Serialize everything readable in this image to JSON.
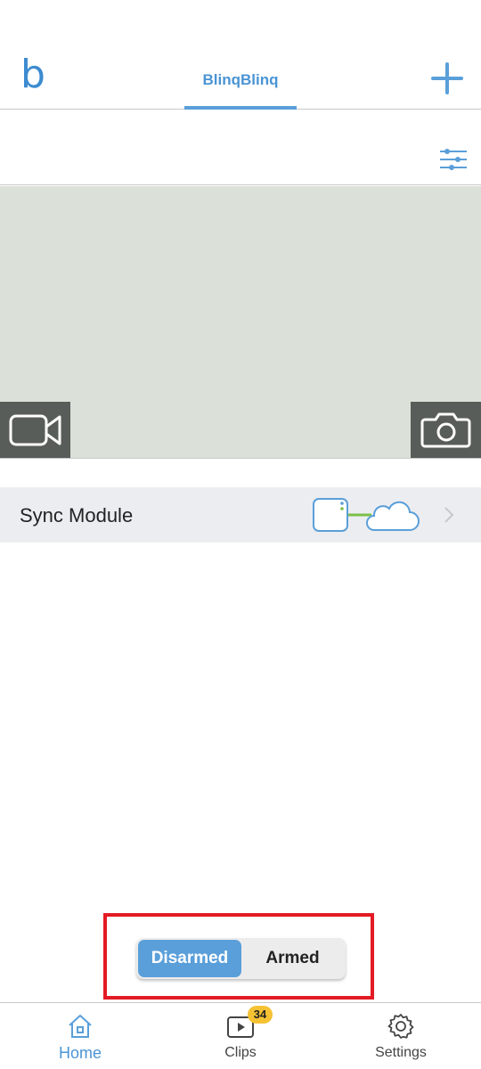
{
  "header": {
    "logo": "b",
    "system_tab": "BlinqBlinq",
    "accent_color": "#5a9fd9",
    "add_icon": "plus-icon"
  },
  "filter": {
    "icon": "sliders-icon"
  },
  "camera": {
    "live_view_icon": "video-camera-icon",
    "snapshot_icon": "camera-icon"
  },
  "sync_module": {
    "label": "Sync Module",
    "status_icon": "module-cloud-connected-icon",
    "status_color": "#7bbf4a"
  },
  "arm_toggle": {
    "disarmed_label": "Disarmed",
    "armed_label": "Armed",
    "selected": "Disarmed"
  },
  "nav": {
    "home_label": "Home",
    "clips_label": "Clips",
    "clips_badge": "34",
    "settings_label": "Settings"
  }
}
